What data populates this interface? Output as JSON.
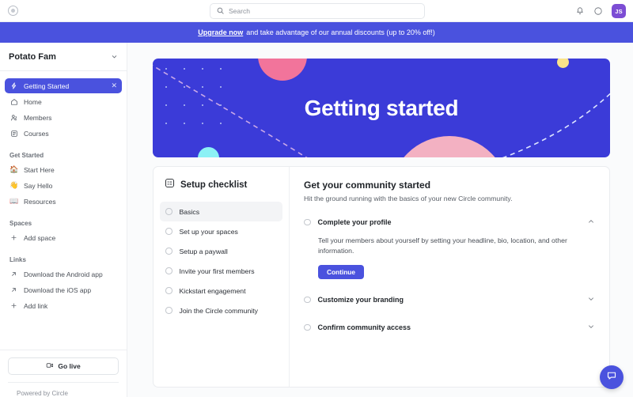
{
  "topbar": {
    "logo_icon": "circle-logo-icon",
    "search": {
      "placeholder": "Search",
      "value": ""
    },
    "notifications_icon": "bell-icon",
    "help_icon": "help-circle-icon",
    "avatar_initials": "JS"
  },
  "promo": {
    "link_text": "Upgrade now",
    "message": "and take advantage of our annual discounts (up to 20% off!)",
    "background": "#4a52de"
  },
  "sidebar": {
    "community_name": "Potato Fam",
    "chevron_icon": "chevron-down-icon",
    "nav": [
      {
        "label": "Getting Started",
        "icon": "lightning-bolt-icon",
        "active": true,
        "close_icon": "close-icon"
      },
      {
        "label": "Home",
        "icon": "home-icon",
        "active": false
      },
      {
        "label": "Members",
        "icon": "members-icon",
        "active": false
      },
      {
        "label": "Courses",
        "icon": "courses-icon",
        "active": false
      }
    ],
    "get_started_label": "Get Started",
    "get_started": [
      {
        "label": "Start Here",
        "emoji": "🏠"
      },
      {
        "label": "Say Hello",
        "emoji": "👋"
      },
      {
        "label": "Resources",
        "emoji": "📖"
      }
    ],
    "spaces_label": "Spaces",
    "add_space_label": "Add space",
    "links_label": "Links",
    "links": [
      {
        "label": "Download the Android app",
        "icon": "external-link-icon"
      },
      {
        "label": "Download the iOS app",
        "icon": "external-link-icon"
      }
    ],
    "add_link_label": "Add link",
    "go_live_label": "Go live",
    "go_live_icon": "video-camera-icon",
    "powered_by": "Powered by Circle"
  },
  "hero": {
    "title": "Getting started",
    "background": "#3b3bd8",
    "accent_pink": "#f2749b",
    "accent_yellow": "#fbe38a",
    "accent_cyan": "#8cf1f5",
    "accent_pink_light": "#f3b1c2"
  },
  "checklist": {
    "icon": "checklist-icon",
    "title": "Setup checklist",
    "items": [
      {
        "label": "Basics",
        "selected": true
      },
      {
        "label": "Set up your spaces",
        "selected": false
      },
      {
        "label": "Setup a paywall",
        "selected": false
      },
      {
        "label": "Invite your first members",
        "selected": false
      },
      {
        "label": "Kickstart engagement",
        "selected": false
      },
      {
        "label": "Join the Circle community",
        "selected": false
      }
    ]
  },
  "panel": {
    "title": "Get your community started",
    "subtitle": "Hit the ground running with the basics of your new Circle community.",
    "sections": [
      {
        "label": "Complete your profile",
        "expanded": true,
        "chevron_icon": "chevron-up-icon",
        "body": "Tell your members about yourself by setting your headline, bio, location, and other information.",
        "cta": "Continue"
      },
      {
        "label": "Customize your branding",
        "expanded": false,
        "chevron_icon": "chevron-down-icon"
      },
      {
        "label": "Confirm community access",
        "expanded": false,
        "chevron_icon": "chevron-down-icon"
      }
    ]
  },
  "chat": {
    "icon": "chat-bubble-icon",
    "color": "#4a52de"
  }
}
